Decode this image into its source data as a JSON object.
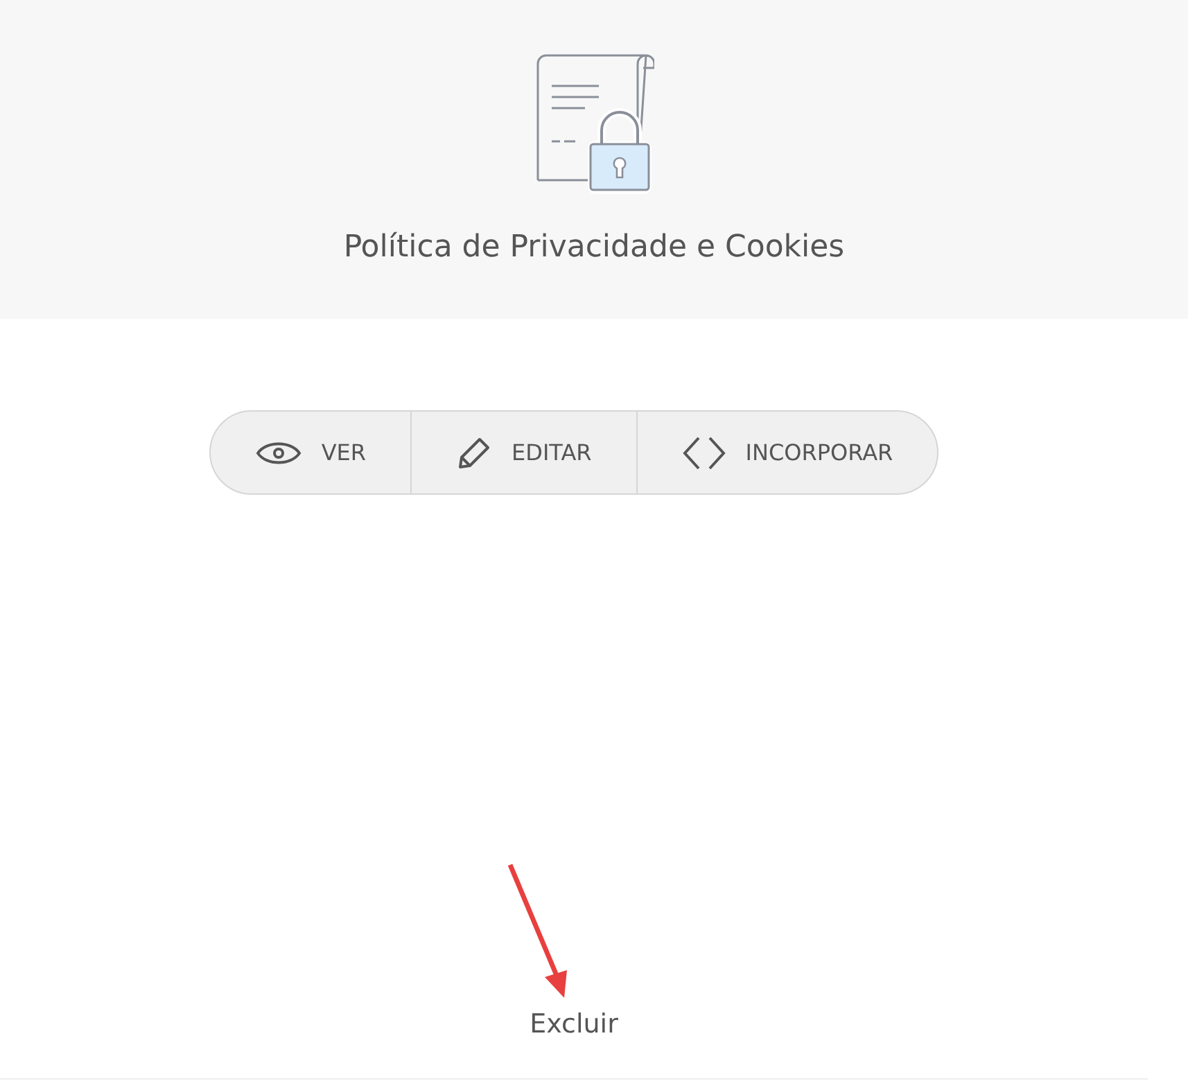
{
  "header": {
    "title": "Política de Privacidade e Cookies"
  },
  "actions": [
    {
      "label": "VER",
      "kind": "view"
    },
    {
      "label": "EDITAR",
      "kind": "edit"
    },
    {
      "label": "INCORPORAR",
      "kind": "embed"
    }
  ],
  "delete_link": {
    "label": "Excluir"
  }
}
